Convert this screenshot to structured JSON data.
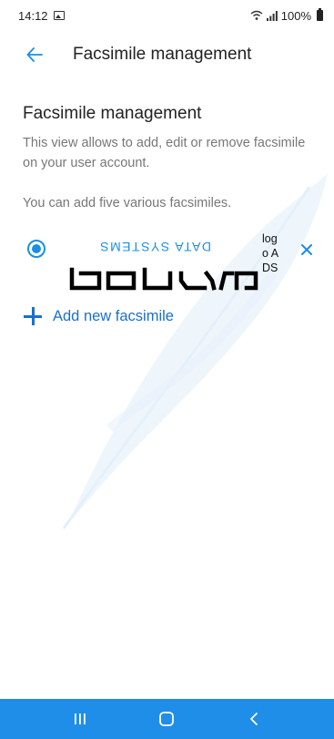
{
  "status_bar": {
    "time": "14:12",
    "battery": "100%",
    "icons": [
      "image-icon",
      "wifi-icon",
      "signal-icon",
      "battery-icon"
    ]
  },
  "app_bar": {
    "back_icon": "arrow-left-icon",
    "title": "Facsimile management"
  },
  "main": {
    "section_title": "Facsimile management",
    "description": "This view allows to add, edit or remove facsimile on your user account.",
    "hint": "You can add five various facsimiles."
  },
  "facsimiles": [
    {
      "selected": true,
      "logo_tagline": "DATA SYSTEMS",
      "logo_wordmark": "asseco",
      "alt_text": "log\no A\nDS",
      "remove_icon": "close-icon"
    }
  ],
  "add_new": {
    "icon": "plus-icon",
    "label": "Add new facsimile"
  },
  "nav_bar": {
    "items": [
      "recents-icon",
      "home-icon",
      "back-icon"
    ]
  },
  "colors": {
    "accent": "#1a8fe3",
    "link": "#1a6fd0",
    "nav_bar": "#1f8ee8",
    "watermark": "#eef6fc",
    "text": "#222222",
    "muted": "#777777"
  }
}
